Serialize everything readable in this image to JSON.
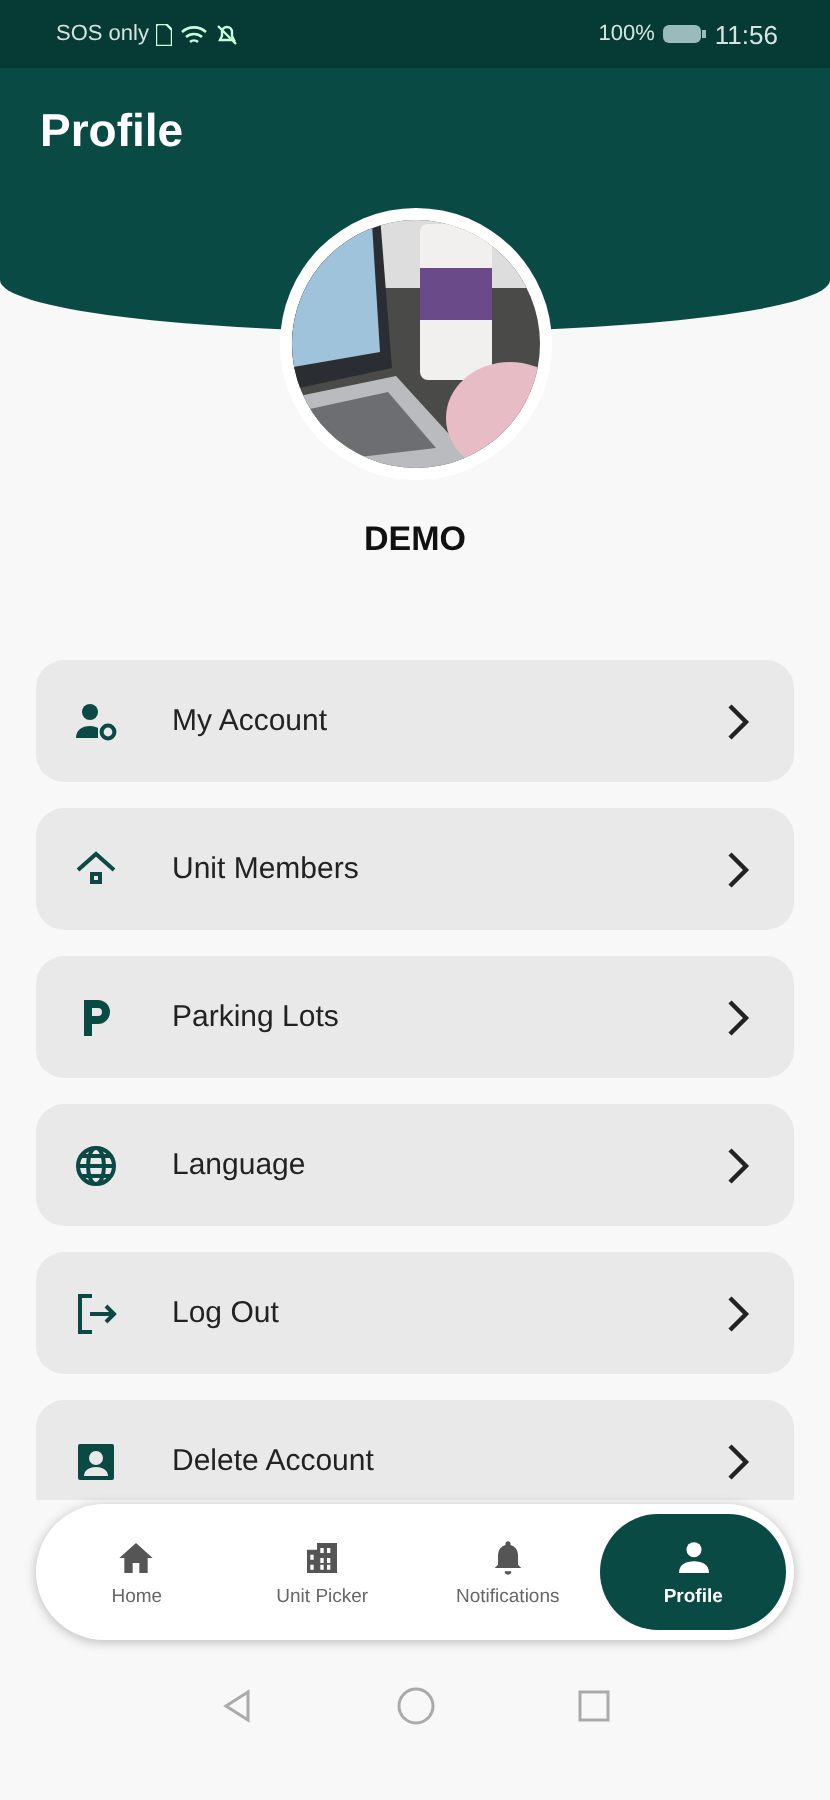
{
  "status_bar": {
    "carrier": "SOS only",
    "battery": "100%",
    "time": "11:56"
  },
  "header": {
    "title": "Profile"
  },
  "profile": {
    "name": "DEMO"
  },
  "menu": [
    {
      "label": "My Account"
    },
    {
      "label": "Unit Members"
    },
    {
      "label": "Parking Lots"
    },
    {
      "label": "Language"
    },
    {
      "label": "Log Out"
    },
    {
      "label": "Delete Account"
    }
  ],
  "bottom_nav": [
    {
      "label": "Home",
      "selected": false
    },
    {
      "label": "Unit Picker",
      "selected": false
    },
    {
      "label": "Notifications",
      "selected": false
    },
    {
      "label": "Profile",
      "selected": true
    }
  ]
}
